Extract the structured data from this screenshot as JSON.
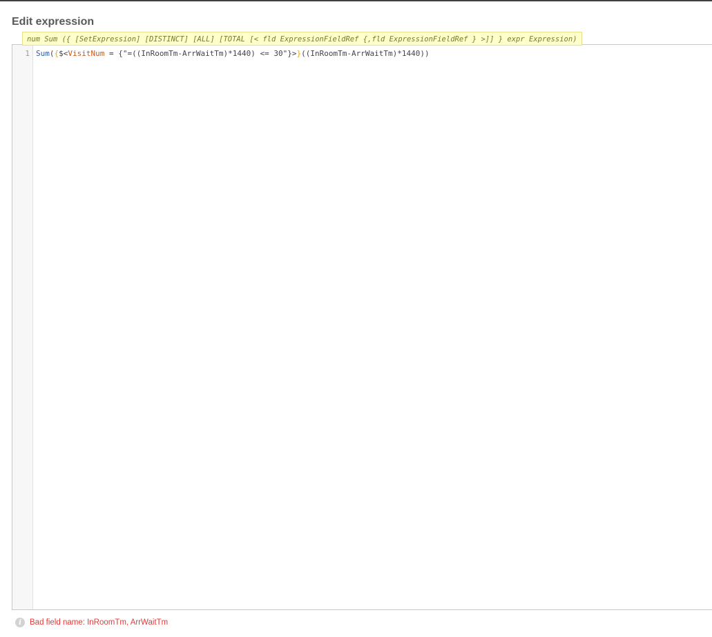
{
  "dialog": {
    "title": "Edit expression"
  },
  "tooltip": {
    "text": "num Sum ({ [SetExpression] [DISTINCT] [ALL] [TOTAL [< fld ExpressionFieldRef {,fld ExpressionFieldRef } >]] } expr Expression)"
  },
  "editor": {
    "line_number": "1",
    "tokens": {
      "fn": "Sum",
      "open_paren": "(",
      "brace_open": "{",
      "set_open": "$<",
      "field": "VisitNum",
      "eq": " = ",
      "search": "{\"=((InRoomTm-ArrWaitTm)*1440) <= 30\"}",
      "set_close": ">",
      "brace_close": "}",
      "expr": "((InRoomTm-ArrWaitTm)*1440))"
    }
  },
  "status": {
    "icon": "info-icon",
    "message": "Bad field name: InRoomTm, ArrWaitTm",
    "color": "#e03a3a"
  }
}
